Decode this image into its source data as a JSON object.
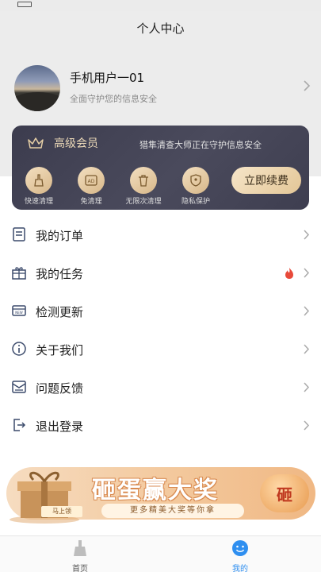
{
  "header": {
    "title": "个人中心"
  },
  "profile": {
    "name": "手机用户一01",
    "subtitle": "全面守护您的信息安全"
  },
  "vip": {
    "title": "高级会员",
    "description": "猎隼清查大师正在守护信息安全",
    "features": [
      {
        "label": "快速清理",
        "icon": "broom-icon"
      },
      {
        "label": "免清理",
        "icon": "ad-icon"
      },
      {
        "label": "无限次清理",
        "icon": "trash-icon"
      },
      {
        "label": "隐私保护",
        "icon": "shield-icon"
      }
    ],
    "renew_label": "立即续费"
  },
  "menu": [
    {
      "label": "我的订单",
      "icon": "order-list-icon"
    },
    {
      "label": "我的任务",
      "icon": "gift-box-icon"
    },
    {
      "label": "检测更新",
      "icon": "update-icon"
    },
    {
      "label": "关于我们",
      "icon": "info-icon"
    },
    {
      "label": "问题反馈",
      "icon": "feedback-icon"
    },
    {
      "label": "退出登录",
      "icon": "logout-icon"
    }
  ],
  "banner": {
    "title": "砸蛋赢大奖",
    "subtitle": "更多精美大奖等你拿",
    "button": "砸",
    "sign": "马上领"
  },
  "tabbar": {
    "tabs": [
      {
        "label": "首页",
        "icon": "broom-icon"
      },
      {
        "label": "我的",
        "icon": "smiley-icon"
      }
    ]
  },
  "colors": {
    "vip_bg": "#45455a",
    "gold": "#e3c697",
    "tab_active": "#2f8ff0",
    "fire": "#e84a3a"
  }
}
